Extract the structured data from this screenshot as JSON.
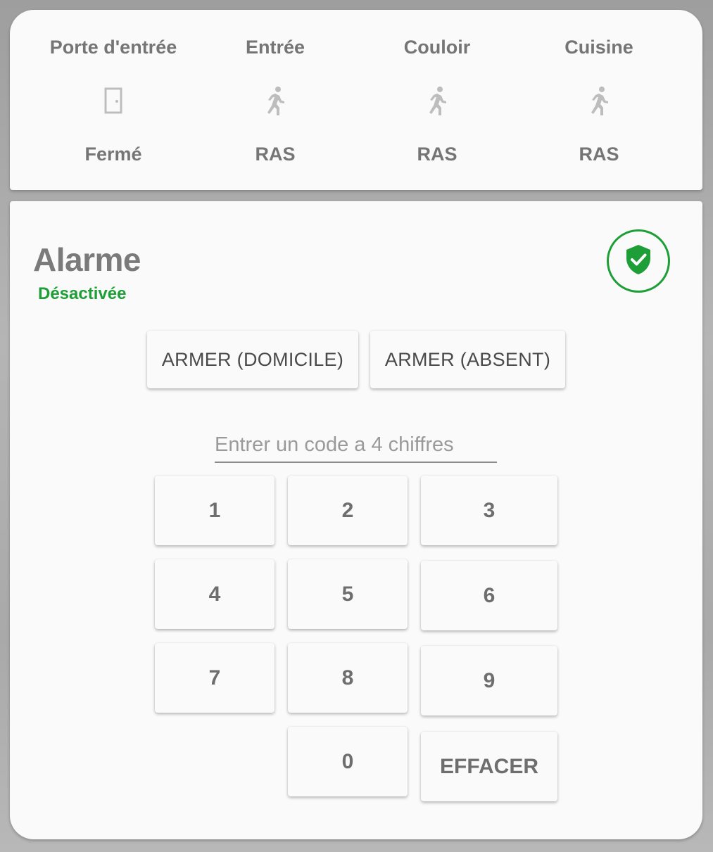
{
  "sensors": [
    {
      "name": "Porte d'entrée",
      "icon": "door-icon",
      "state": "Fermé"
    },
    {
      "name": "Entrée",
      "icon": "motion-sensor-icon",
      "state": "RAS"
    },
    {
      "name": "Couloir",
      "icon": "motion-sensor-icon",
      "state": "RAS"
    },
    {
      "name": "Cuisine",
      "icon": "motion-sensor-icon",
      "state": "RAS"
    }
  ],
  "alarm": {
    "title": "Alarme",
    "status": "Désactivée",
    "status_icon": "shield-check-icon",
    "status_color": "#1e9e37",
    "arm_home_label": "ARMER (DOMICILE)",
    "arm_away_label": "ARMER (ABSENT)",
    "code_placeholder": "Entrer un code a 4 chiffres",
    "code_value": "",
    "keypad": {
      "k1": "1",
      "k2": "2",
      "k3": "3",
      "k4": "4",
      "k5": "5",
      "k6": "6",
      "k7": "7",
      "k8": "8",
      "k9": "9",
      "k0": "0",
      "clear": "EFFACER"
    }
  },
  "colors": {
    "card_background": "#fafafa",
    "text_muted": "#757575",
    "accent_green": "#1e9e37",
    "icon_gray": "#bdbdbd"
  }
}
